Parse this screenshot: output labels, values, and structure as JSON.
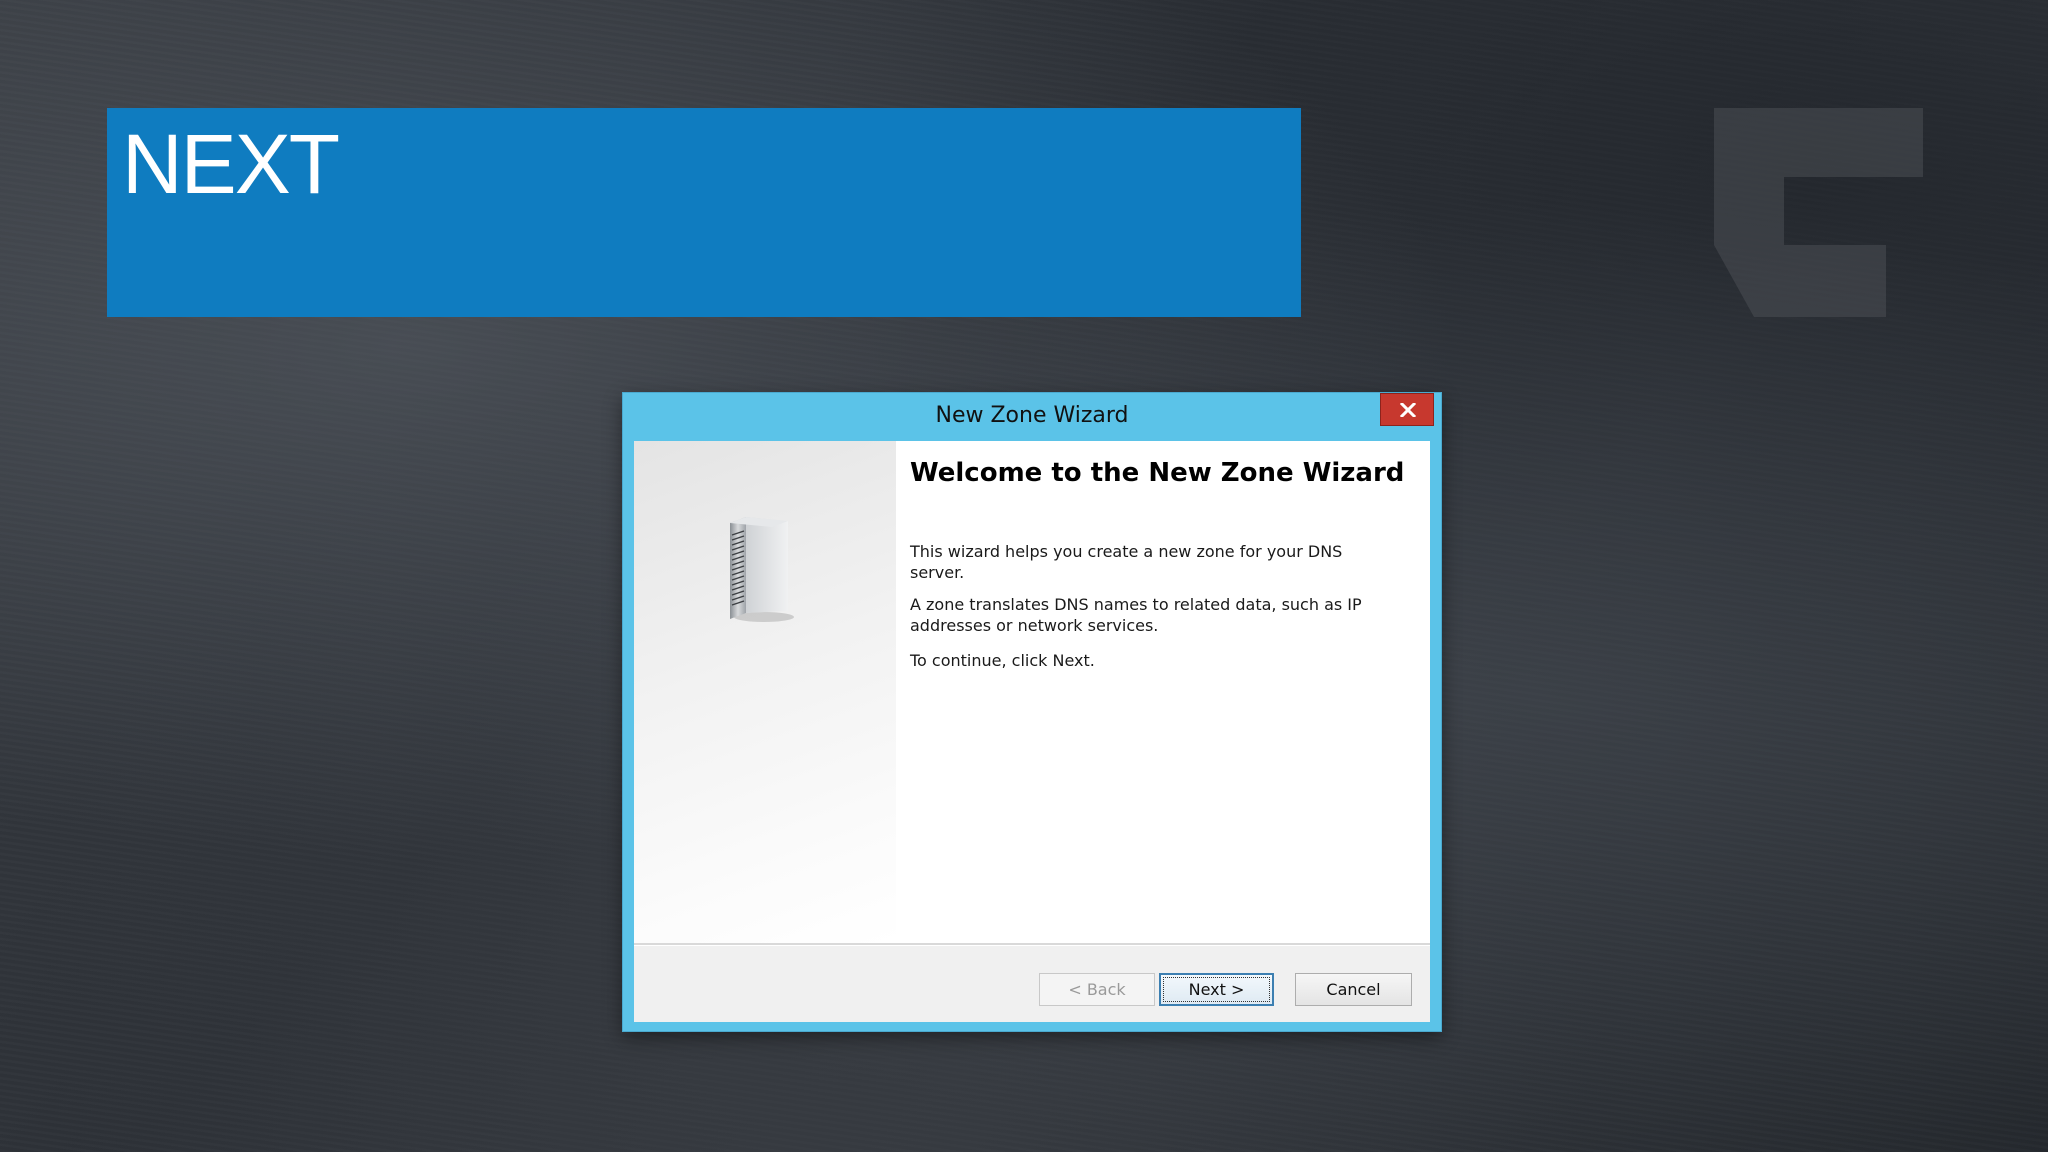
{
  "slide": {
    "title": "NEXT",
    "banner_color": "#0f7cc0"
  },
  "window": {
    "title": "New Zone Wizard",
    "titlebar_color": "#5bc3e8",
    "close_icon": "close-icon"
  },
  "wizard": {
    "side_icon": "server-tower-icon",
    "heading": "Welcome to the New Zone Wizard",
    "paragraphs": [
      "This wizard helps you create a new zone for your DNS server.",
      "A zone translates DNS names to related data, such as IP addresses or network services.",
      "To continue, click Next."
    ]
  },
  "buttons": {
    "back_label": "< Back",
    "next_label": "Next >",
    "cancel_label": "Cancel"
  }
}
